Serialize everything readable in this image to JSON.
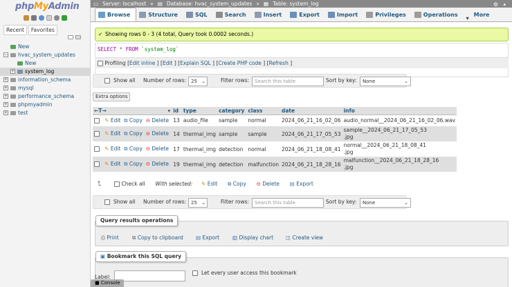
{
  "sidebar": {
    "logo_php": "php",
    "logo_my": "My",
    "logo_admin": "Admin",
    "tabs": [
      "Recent",
      "Favorites"
    ],
    "tree": [
      {
        "label": "New",
        "level": 0,
        "selected": false
      },
      {
        "label": "hvac_system_updates",
        "level": 0,
        "selected": false
      },
      {
        "label": "New",
        "level": 1,
        "selected": false
      },
      {
        "label": "system_log",
        "level": 1,
        "selected": true
      },
      {
        "label": "information_schema",
        "level": 0,
        "selected": false
      },
      {
        "label": "mysql",
        "level": 0,
        "selected": false
      },
      {
        "label": "performance_schema",
        "level": 0,
        "selected": false
      },
      {
        "label": "phpmyadmin",
        "level": 0,
        "selected": false
      },
      {
        "label": "test",
        "level": 0,
        "selected": false
      }
    ]
  },
  "topbar": {
    "server": "Server: localhost",
    "database": "Database: hvac_system_updates",
    "table": "Table: system_log",
    "sep": "»"
  },
  "tabs": [
    {
      "label": "Browse",
      "active": true,
      "color": "#6a9ec8"
    },
    {
      "label": "Structure",
      "active": false,
      "color": "#8a9bb3"
    },
    {
      "label": "SQL",
      "active": false,
      "color": "#7f90a8"
    },
    {
      "label": "Search",
      "active": false,
      "color": "#8c8c8c"
    },
    {
      "label": "Insert",
      "active": false,
      "color": "#8e9ab0"
    },
    {
      "label": "Export",
      "active": false,
      "color": "#6c8fb8"
    },
    {
      "label": "Import",
      "active": false,
      "color": "#6c8fb8"
    },
    {
      "label": "Privileges",
      "active": false,
      "color": "#9b9b9b"
    },
    {
      "label": "Operations",
      "active": false,
      "color": "#9b9b9b"
    },
    {
      "label": "More",
      "active": false,
      "color": ""
    }
  ],
  "success_message": "Showing rows 0 - 3 (4 total, Query took 0.0002 seconds.)",
  "sql": {
    "select": "SELECT",
    "star": "*",
    "from": "FROM",
    "table": "`system_log`"
  },
  "profiling": {
    "label": "Profiling",
    "links": [
      "Edit inline",
      "Edit",
      "Explain SQL",
      "Create PHP code",
      "Refresh"
    ]
  },
  "nav": {
    "show_all": "Show all",
    "num_rows_label": "Number of rows:",
    "num_rows": "25",
    "filter_label": "Filter rows:",
    "filter_placeholder": "Search this table",
    "sort_label": "Sort by key:",
    "sort_value": "None"
  },
  "extra_options": "Extra options",
  "table": {
    "arrows": "←T→",
    "columns": [
      "id",
      "type",
      "category",
      "class",
      "date",
      "info"
    ],
    "actions": {
      "edit": "Edit",
      "copy": "Copy",
      "delete": "Delete"
    },
    "rows": [
      {
        "id": "13",
        "type": "audio_file",
        "category": "sample",
        "class": "normal",
        "date": "2024_06_21_16_02_06",
        "info1": "audio_normal__2024_06_21_16_02_06.wav",
        "info2": ""
      },
      {
        "id": "14",
        "type": "thermal_img",
        "category": "sample",
        "class": "sample",
        "date": "2024_06_21_17_05_53",
        "info1": "sample__2024_06_21_17_05_53",
        "info2": ".jpg"
      },
      {
        "id": "17",
        "type": "thermal_img",
        "category": "detection",
        "class": "normal",
        "date": "2024_06_21_18_08_41",
        "info1": "normal__2024_06_21_18_08_41",
        "info2": ".jpg"
      },
      {
        "id": "19",
        "type": "thermal_img",
        "category": "detection",
        "class": "malfunction",
        "date": "2024_06_21_18_28_16",
        "info1": "malfunction__2024_06_21_18_28_16",
        "info2": ".jpg"
      }
    ]
  },
  "with_selected": {
    "check_all": "Check all",
    "label": "With selected:",
    "edit": "Edit",
    "copy": "Copy",
    "delete": "Delete",
    "export": "Export"
  },
  "ops": {
    "legend": "Query results operations",
    "print": "Print",
    "copy_clipboard": "Copy to clipboard",
    "export": "Export",
    "display_chart": "Display chart",
    "create_view": "Create view"
  },
  "bookmark": {
    "legend": "Bookmark this SQL query",
    "label": "Label:",
    "every_user": "Let every user access this bookmark"
  },
  "console": "Console"
}
